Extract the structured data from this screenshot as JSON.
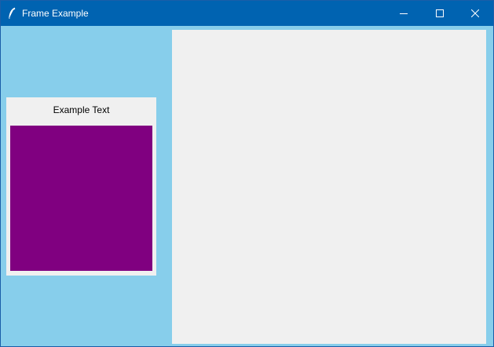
{
  "window": {
    "title": "Frame Example",
    "background_color": "#87ceeb",
    "titlebar_color": "#0063b1",
    "icons": {
      "app": "feather-icon",
      "minimize": "minimize-icon",
      "maximize": "maximize-icon",
      "close": "close-icon"
    }
  },
  "left_frame": {
    "label": "Example Text",
    "background_color": "#f0f0f0",
    "box_color": "#800080"
  },
  "right_frame": {
    "background_color": "#f0f0f0"
  }
}
